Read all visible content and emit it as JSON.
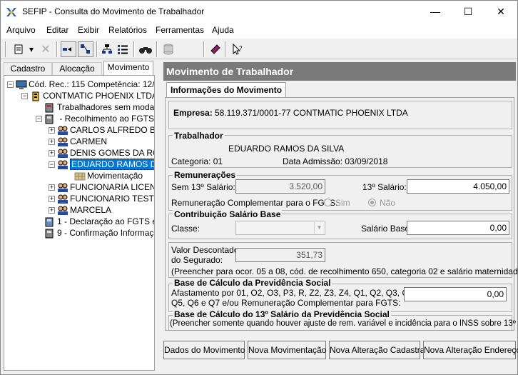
{
  "window": {
    "title": "SEFIP - Consulta do Movimento de Trabalhador"
  },
  "menu": [
    "Arquivo",
    "Editar",
    "Exibir",
    "Relatórios",
    "Ferramentas",
    "Ajuda"
  ],
  "left_tabs": [
    "Cadastro",
    "Alocação",
    "Movimento"
  ],
  "tree": [
    {
      "label": "Cód. Rec.: 115 Competência: 12/20",
      "icon": "monitor-icon"
    },
    {
      "label": "CONTMATIC PHOENIX LTDA",
      "icon": "company-icon"
    },
    {
      "label": "Trabalhadores sem modalid",
      "icon": "cabinet-icon"
    },
    {
      "label": " - Recolhimento ao FGTS",
      "icon": "cabinet-icon"
    },
    {
      "label": "CARLOS ALFREDO BA",
      "icon": "people-icon"
    },
    {
      "label": "CARMEN",
      "icon": "people-icon"
    },
    {
      "label": "DENIS GOMES DA RO",
      "icon": "people-icon"
    },
    {
      "label": "EDUARDO RAMOS DA",
      "icon": "people-icon"
    },
    {
      "label": "Movimentação",
      "icon": "grid-icon"
    },
    {
      "label": "FUNCIONARIA LICENC",
      "icon": "people-icon"
    },
    {
      "label": "FUNCIONARIO TESTE",
      "icon": "people-icon"
    },
    {
      "label": "MARCELA",
      "icon": "people-icon"
    },
    {
      "label": "1 - Declaração ao FGTS e ..",
      "icon": "cabinet-icon"
    },
    {
      "label": "9 - Confirmação Informaçõe",
      "icon": "cabinet-icon"
    }
  ],
  "panel": {
    "title": "Movimento de Trabalhador",
    "tab": "Informações do Movimento",
    "empresa_label": "Empresa:",
    "empresa_value": "58.119.371/0001-77  CONTMATIC PHOENIX LTDA",
    "trabalhador": {
      "title": "Trabalhador",
      "name": "EDUARDO RAMOS DA SILVA",
      "categoria_label": "Categoria: 01",
      "admissao_label": "Data Admissão: 03/09/2018"
    },
    "remuneracoes": {
      "title": "Remunerações",
      "sem13_label": "Sem 13º Salário:",
      "sem13_value": "3.520,00",
      "com13_label": "13º Salário:",
      "com13_value": "4.050,00",
      "complementar_label": "Remuneração Complementar para o FGTS:",
      "sim": "Sim",
      "nao": "Não"
    },
    "contribuicao": {
      "title": "Contribuição Salário Base",
      "classe_label": "Classe:",
      "salario_base_label": "Salário Base:",
      "salario_base_value": "0,00"
    },
    "valor_descontado": {
      "label1": "Valor Descontado",
      "label2": "do Segurado:",
      "value": "351,73",
      "note": "(Preencher para ocor. 05 a 08, cód. de recolhimento 650, categoria 02 e salário maternidade)"
    },
    "previdencia": {
      "title": "Base de Cálculo da Previdência Social",
      "line1": "Afastamento por 01, O2, O3, P3, R, Z2, Z3, Z4, Q1, Q2, Q3, Q4,",
      "line2": "Q5, Q6 e Q7  e/ou Remuneração Complementar para FGTS:",
      "value": "0,00"
    },
    "previdencia13": {
      "title": "Base de Cálculo do 13º Salário da Previdência Social",
      "note": "(Preencher somente quando houver ajuste de rem. variável e incidência para o INSS sobre 13º salário"
    }
  },
  "buttons": [
    "Dados do Movimento",
    "Nova Movimentação",
    "Nova Alteração Cadastral",
    "Nova Alteração Endereço"
  ]
}
